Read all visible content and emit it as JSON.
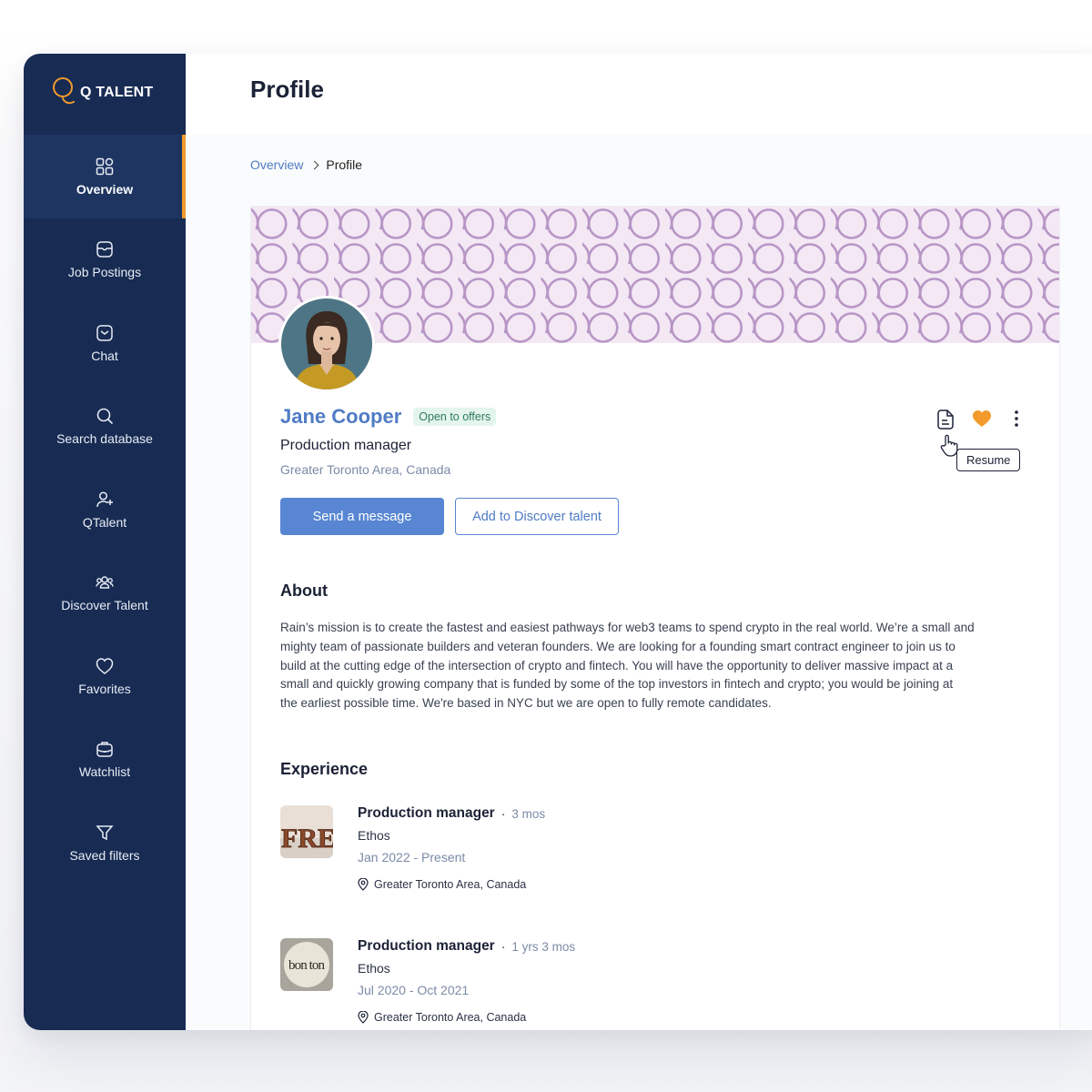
{
  "brand": {
    "name": "Q TALENT",
    "accent": "#f39a2c",
    "sidebar_bg": "#172b53"
  },
  "sidebar": {
    "items": [
      {
        "label": "Overview",
        "icon": "grid-icon",
        "active": true
      },
      {
        "label": "Job Postings",
        "icon": "folder-icon"
      },
      {
        "label": "Chat",
        "icon": "chat-icon"
      },
      {
        "label": "Search database",
        "icon": "search-icon"
      },
      {
        "label": "QTalent",
        "icon": "user-add-icon"
      },
      {
        "label": "Discover Talent",
        "icon": "users-icon"
      },
      {
        "label": "Favorites",
        "icon": "heart-icon"
      },
      {
        "label": "Watchlist",
        "icon": "briefcase-icon"
      },
      {
        "label": "Saved filters",
        "icon": "filter-icon"
      }
    ]
  },
  "header": {
    "title": "Profile"
  },
  "breadcrumb": {
    "parent": "Overview",
    "current": "Profile"
  },
  "profile": {
    "name": "Jane Cooper",
    "status_badge": "Open to offers",
    "title": "Production manager",
    "location": "Greater Toronto Area, Canada",
    "send_message_label": "Send a message",
    "add_discover_label": "Add to Discover talent",
    "resume_tooltip": "Resume"
  },
  "about": {
    "heading": "About",
    "lines": [
      "Rain’s mission is to create the fastest and easiest pathways for web3 teams to spend crypto in the real world. We’re a small and",
      "mighty team of passionate builders and veteran founders. We are looking for a founding smart contract engineer to join us to",
      "build at the cutting edge of the intersection of crypto and fintech. You will have the opportunity to deliver massive impact at a",
      "small and quickly growing company that is funded by some of the top investors in fintech and crypto; you would be joining at",
      "the earliest possible time. We're based in NYC but we are open to fully remote candidates."
    ]
  },
  "experience": {
    "heading": "Experience",
    "items": [
      {
        "role": "Production manager",
        "duration": "3 mos",
        "company": "Ethos",
        "dates": "Jan 2022 - Present",
        "location": "Greater Toronto Area, Canada",
        "logo_text": "FRE"
      },
      {
        "role": "Production manager",
        "duration": "1 yrs 3 mos",
        "company": "Ethos",
        "dates": "Jul 2020 - Oct 2021",
        "location": "Greater Toronto Area, Canada",
        "logo_text": "bon ton"
      }
    ]
  }
}
